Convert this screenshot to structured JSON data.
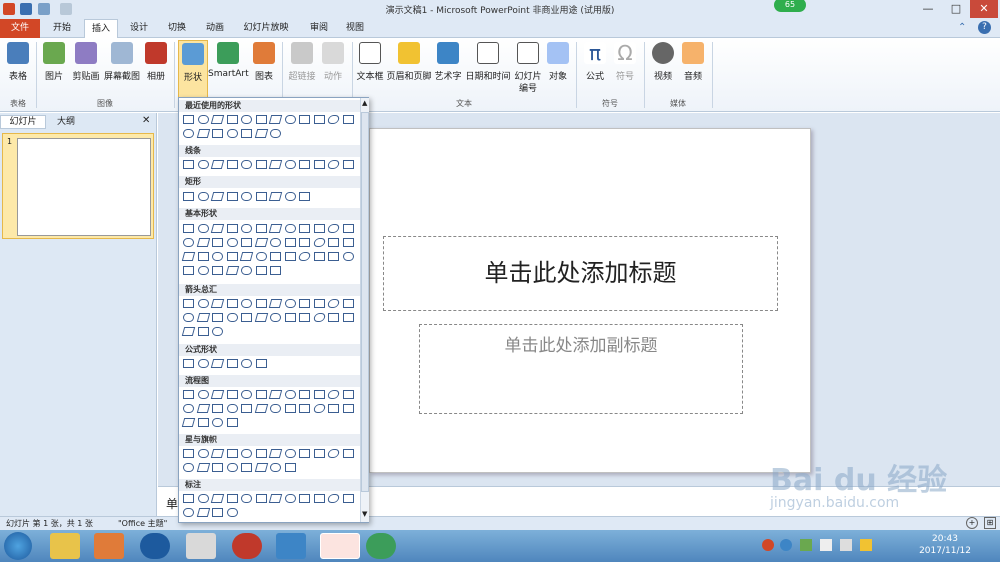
{
  "window": {
    "title": "演示文稿1 - Microsoft PowerPoint 非商业用途 (试用版)",
    "badge": "65",
    "min": "—",
    "max": "□",
    "close": "✕"
  },
  "tabs": [
    "文件",
    "开始",
    "插入",
    "设计",
    "切换",
    "动画",
    "幻灯片放映",
    "审阅",
    "视图"
  ],
  "ribbon": {
    "buttons": [
      {
        "l": "表格"
      },
      {
        "l": "图片"
      },
      {
        "l": "剪贴画"
      },
      {
        "l": "屏幕截图"
      },
      {
        "l": "相册"
      },
      {
        "l": "形状"
      },
      {
        "l": "SmartArt"
      },
      {
        "l": "图表"
      },
      {
        "l": "超链接"
      },
      {
        "l": "动作"
      },
      {
        "l": "文本框"
      },
      {
        "l": "页眉和页脚"
      },
      {
        "l": "艺术字"
      },
      {
        "l": "日期和时间"
      },
      {
        "l": "幻灯片",
        "l2": "编号"
      },
      {
        "l": "对象"
      },
      {
        "l": "公式"
      },
      {
        "l": "符号"
      },
      {
        "l": "视频"
      },
      {
        "l": "音频"
      }
    ],
    "groups": [
      "表格",
      "图像",
      "文本",
      "符号",
      "媒体"
    ]
  },
  "panel": {
    "tab_slides": "幻灯片",
    "tab_outline": "大纲",
    "close": "✕",
    "slide_num": "1"
  },
  "gallery": {
    "sections": [
      "最近使用的形状",
      "线条",
      "矩形",
      "基本形状",
      "箭头总汇",
      "公式形状",
      "流程图",
      "星与旗帜",
      "标注"
    ]
  },
  "slide": {
    "title_placeholder": "单击此处添加标题",
    "subtitle_placeholder": "单击此处添加副标题"
  },
  "notes": {
    "placeholder": "单"
  },
  "status": {
    "slide_info": "幻灯片 第 1 张，共 1 张",
    "theme": "\"Office 主题\""
  },
  "taskbar": {
    "time": "20:43",
    "date": "2017/11/12"
  },
  "watermark": {
    "text": "Bai du 经验",
    "url": "jingyan.baidu.com"
  }
}
